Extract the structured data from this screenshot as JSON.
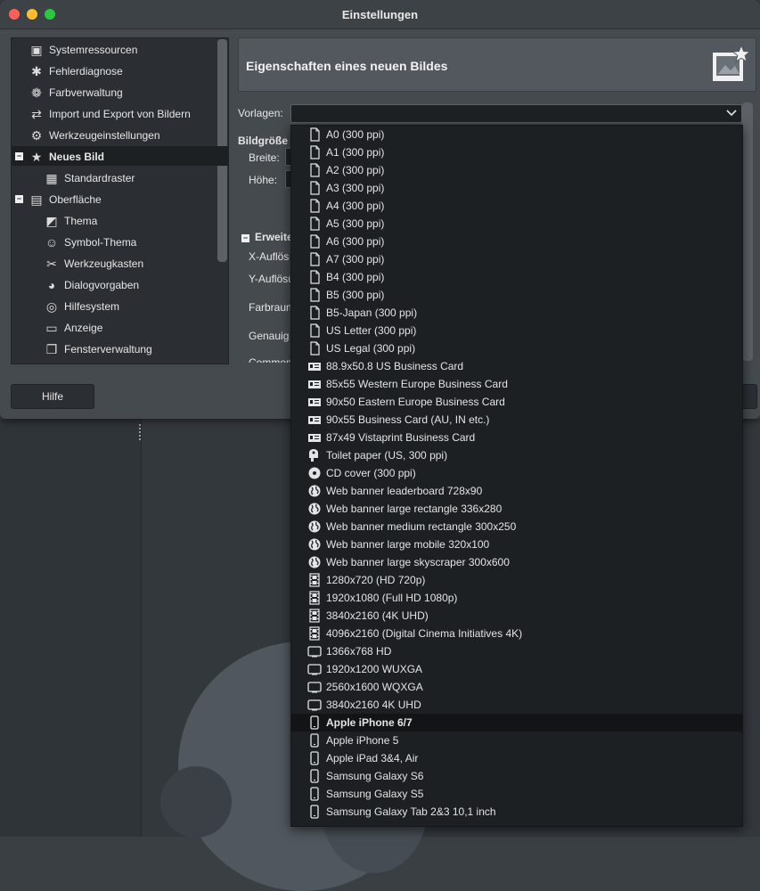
{
  "window": {
    "title": "Einstellungen"
  },
  "tree": {
    "items": [
      {
        "label": "Systemressourcen",
        "icon": "chip-icon",
        "glyph": "▣",
        "level": 0,
        "selected": false
      },
      {
        "label": "Fehlerdiagnose",
        "icon": "wilber-bug-icon",
        "glyph": "✱",
        "level": 0,
        "selected": false
      },
      {
        "label": "Farbverwaltung",
        "icon": "color-circles-icon",
        "glyph": "❁",
        "level": 0,
        "selected": false
      },
      {
        "label": "Import und Export von Bildern",
        "icon": "import-export-icon",
        "glyph": "⇄",
        "level": 0,
        "selected": false
      },
      {
        "label": "Werkzeugeinstellungen",
        "icon": "tool-options-icon",
        "glyph": "⚙",
        "level": 0,
        "selected": false
      },
      {
        "label": "Neues Bild",
        "icon": "new-image-icon",
        "glyph": "★",
        "level": 0,
        "selected": true,
        "expander": "collapse"
      },
      {
        "label": "Standardraster",
        "icon": "grid-icon",
        "glyph": "▦",
        "level": 1,
        "selected": false
      },
      {
        "label": "Oberfläche",
        "icon": "interface-icon",
        "glyph": "▤",
        "level": 0,
        "selected": false,
        "expander": "collapse"
      },
      {
        "label": "Thema",
        "icon": "theme-icon",
        "glyph": "◩",
        "level": 1,
        "selected": false
      },
      {
        "label": "Symbol-Thema",
        "icon": "icon-theme-icon",
        "glyph": "☺",
        "level": 1,
        "selected": false
      },
      {
        "label": "Werkzeugkasten",
        "icon": "toolbox-icon",
        "glyph": "✂",
        "level": 1,
        "selected": false
      },
      {
        "label": "Dialogvorgaben",
        "icon": "dialog-defaults-icon",
        "glyph": "◕",
        "level": 1,
        "selected": false
      },
      {
        "label": "Hilfesystem",
        "icon": "lifebuoy-icon",
        "glyph": "◎",
        "level": 1,
        "selected": false
      },
      {
        "label": "Anzeige",
        "icon": "display-icon",
        "glyph": "▭",
        "level": 1,
        "selected": false
      },
      {
        "label": "Fensterverwaltung",
        "icon": "window-management-icon",
        "glyph": "❐",
        "level": 1,
        "selected": false
      }
    ]
  },
  "header": {
    "title": "Eigenschaften eines neuen Bildes",
    "icon": "new-image-star-icon"
  },
  "form": {
    "templates_label": "Vorlagen:",
    "templates_value": "",
    "image_size_label": "Bildgröße",
    "width_label": "Breite:",
    "height_label": "Höhe:",
    "advanced_label": "Erweite",
    "x_res_label": "X-Auflös",
    "y_res_label": "Y-Auflösu",
    "colorspace_label": "Farbraun",
    "precision_label": "Genauig",
    "comment_label": "Commen"
  },
  "buttons": {
    "help": "Hilfe"
  },
  "dropdown": {
    "highlighted_index": 33,
    "items": [
      {
        "label": "A0 (300 ppi)",
        "icon": "page-icon"
      },
      {
        "label": "A1 (300 ppi)",
        "icon": "page-icon"
      },
      {
        "label": "A2 (300 ppi)",
        "icon": "page-icon"
      },
      {
        "label": "A3 (300 ppi)",
        "icon": "page-icon"
      },
      {
        "label": "A4 (300 ppi)",
        "icon": "page-icon"
      },
      {
        "label": "A5 (300 ppi)",
        "icon": "page-icon"
      },
      {
        "label": "A6 (300 ppi)",
        "icon": "page-icon"
      },
      {
        "label": "A7 (300 ppi)",
        "icon": "page-icon"
      },
      {
        "label": "B4 (300 ppi)",
        "icon": "page-icon"
      },
      {
        "label": "B5 (300 ppi)",
        "icon": "page-icon"
      },
      {
        "label": "B5-Japan (300 ppi)",
        "icon": "page-icon"
      },
      {
        "label": "US Letter (300 ppi)",
        "icon": "page-icon"
      },
      {
        "label": "US Legal (300 ppi)",
        "icon": "page-icon"
      },
      {
        "label": "88.9x50.8 US Business Card",
        "icon": "business-card-icon"
      },
      {
        "label": "85x55 Western Europe Business Card",
        "icon": "business-card-icon"
      },
      {
        "label": "90x50 Eastern Europe Business Card",
        "icon": "business-card-icon"
      },
      {
        "label": "90x55 Business Card (AU, IN etc.)",
        "icon": "business-card-icon"
      },
      {
        "label": "87x49 Vistaprint Business Card",
        "icon": "business-card-icon"
      },
      {
        "label": "Toilet paper (US, 300 ppi)",
        "icon": "toilet-paper-icon"
      },
      {
        "label": "CD cover (300 ppi)",
        "icon": "cd-icon"
      },
      {
        "label": "Web banner leaderboard 728x90",
        "icon": "globe-icon"
      },
      {
        "label": "Web banner large rectangle 336x280",
        "icon": "globe-icon"
      },
      {
        "label": "Web banner medium rectangle 300x250",
        "icon": "globe-icon"
      },
      {
        "label": "Web banner large mobile 320x100",
        "icon": "globe-icon"
      },
      {
        "label": "Web banner large skyscraper 300x600",
        "icon": "globe-icon"
      },
      {
        "label": "1280x720 (HD 720p)",
        "icon": "film-icon"
      },
      {
        "label": "1920x1080 (Full HD 1080p)",
        "icon": "film-icon"
      },
      {
        "label": "3840x2160 (4K UHD)",
        "icon": "film-icon"
      },
      {
        "label": "4096x2160 (Digital Cinema Initiatives 4K)",
        "icon": "film-icon"
      },
      {
        "label": "1366x768 HD",
        "icon": "monitor-icon"
      },
      {
        "label": "1920x1200 WUXGA",
        "icon": "monitor-icon"
      },
      {
        "label": "2560x1600 WQXGA",
        "icon": "monitor-icon"
      },
      {
        "label": "3840x2160 4K UHD",
        "icon": "monitor-icon"
      },
      {
        "label": "Apple iPhone 6/7",
        "icon": "phone-icon"
      },
      {
        "label": "Apple iPhone 5",
        "icon": "phone-icon"
      },
      {
        "label": "Apple iPad 3&4, Air",
        "icon": "phone-icon"
      },
      {
        "label": "Samsung Galaxy S6",
        "icon": "phone-icon"
      },
      {
        "label": "Samsung Galaxy S5",
        "icon": "phone-icon"
      },
      {
        "label": "Samsung Galaxy Tab 2&3 10,1 inch",
        "icon": "phone-icon"
      }
    ]
  }
}
